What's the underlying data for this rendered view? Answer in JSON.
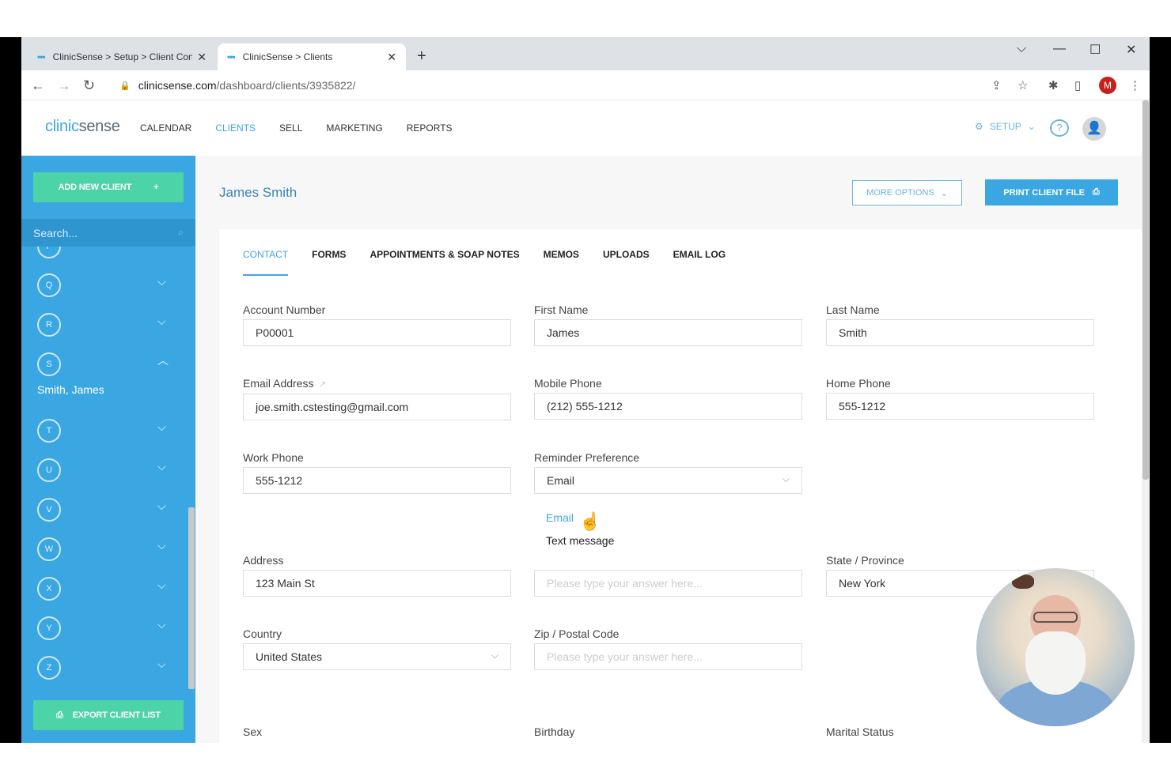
{
  "browser": {
    "tabs": [
      {
        "title": "ClinicSense > Setup > Client Con"
      },
      {
        "title": "ClinicSense > Clients"
      }
    ],
    "url_host": "clinicsense.com",
    "url_path": "/dashboard/clients/3935822/",
    "profile_initial": "M"
  },
  "app": {
    "logo_a": "clinic",
    "logo_b": "sense",
    "nav": [
      "CALENDAR",
      "CLIENTS",
      "SELL",
      "MARKETING",
      "REPORTS"
    ],
    "active_nav": "CLIENTS",
    "setup_label": "SETUP"
  },
  "sidebar": {
    "add_client_label": "ADD NEW CLIENT",
    "search_placeholder": "Search...",
    "letters": [
      "P",
      "Q",
      "R",
      "S",
      "T",
      "U",
      "V",
      "W",
      "X",
      "Y",
      "Z"
    ],
    "expanded_letter": "S",
    "expanded_client": "Smith, James",
    "export_label": "EXPORT CLIENT LIST"
  },
  "client": {
    "name": "James Smith",
    "more_options_label": "MORE OPTIONS",
    "print_label": "PRINT CLIENT FILE"
  },
  "tabs": [
    "CONTACT",
    "FORMS",
    "APPOINTMENTS & SOAP NOTES",
    "MEMOS",
    "UPLOADS",
    "EMAIL LOG"
  ],
  "active_tab": "CONTACT",
  "fields": {
    "account_number": {
      "label": "Account Number",
      "value": "P00001"
    },
    "first_name": {
      "label": "First Name",
      "value": "James"
    },
    "last_name": {
      "label": "Last Name",
      "value": "Smith"
    },
    "email": {
      "label": "Email Address",
      "value": "joe.smith.cstesting@gmail.com"
    },
    "mobile_phone": {
      "label": "Mobile Phone",
      "value": "(212) 555-1212"
    },
    "home_phone": {
      "label": "Home Phone",
      "value": "555-1212"
    },
    "work_phone": {
      "label": "Work Phone",
      "value": "555-1212"
    },
    "reminder_pref": {
      "label": "Reminder Preference",
      "value": "Email",
      "options": [
        "Email",
        "Text message"
      ]
    },
    "address": {
      "label": "Address",
      "value": "123 Main St"
    },
    "address2": {
      "placeholder": "Please type your answer here..."
    },
    "state": {
      "label": "State / Province",
      "value": "New York"
    },
    "country": {
      "label": "Country",
      "value": "United States"
    },
    "zip": {
      "label": "Zip / Postal Code",
      "placeholder": "Please type your answer here..."
    },
    "sex": {
      "label": "Sex"
    },
    "birthday": {
      "label": "Birthday"
    },
    "marital_status": {
      "label": "Marital Status"
    }
  },
  "colors": {
    "accent": "#3aa7e2",
    "green": "#4cd3a8"
  }
}
